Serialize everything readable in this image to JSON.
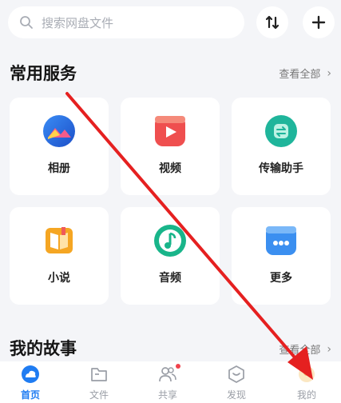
{
  "search": {
    "placeholder": "搜索网盘文件",
    "icon": "search-icon"
  },
  "top_actions": {
    "sort_icon": "sort-arrows-icon",
    "add_icon": "plus-icon"
  },
  "services": {
    "title": "常用服务",
    "see_all": "查看全部",
    "items": [
      {
        "label": "相册",
        "icon": "album-icon",
        "color": "#2f6fe0"
      },
      {
        "label": "视频",
        "icon": "video-icon",
        "color": "#ef4f4f"
      },
      {
        "label": "传输助手",
        "icon": "transfer-assistant-icon",
        "color": "#1fb59b"
      },
      {
        "label": "小说",
        "icon": "novel-icon",
        "color": "#f5a623"
      },
      {
        "label": "音频",
        "icon": "audio-icon",
        "color": "#19b58a"
      },
      {
        "label": "更多",
        "icon": "more-icon",
        "color": "#3b8ff0"
      }
    ]
  },
  "stories": {
    "title": "我的故事",
    "see_all": "查看全部"
  },
  "tabs": [
    {
      "label": "首页",
      "icon": "home-cloud-icon",
      "active": true
    },
    {
      "label": "文件",
      "icon": "folder-icon",
      "active": false
    },
    {
      "label": "共享",
      "icon": "share-people-icon",
      "active": false,
      "badge": true
    },
    {
      "label": "发现",
      "icon": "discover-icon",
      "active": false
    },
    {
      "label": "我的",
      "icon": "profile-icon",
      "active": false
    }
  ],
  "colors": {
    "accent": "#1f7cf2",
    "annotation_arrow": "#e52020",
    "badge": "#f0424c"
  }
}
